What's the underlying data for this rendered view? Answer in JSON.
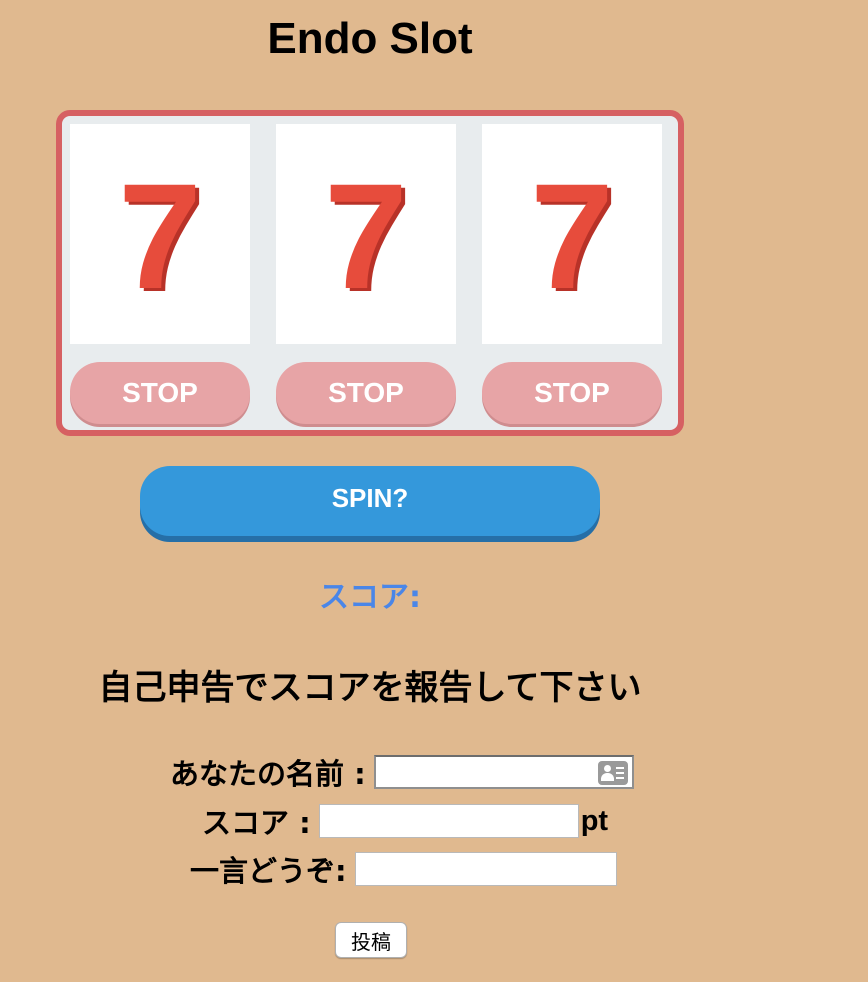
{
  "title": "Endo Slot",
  "reels": [
    {
      "symbol": "7",
      "stop_label": "STOP"
    },
    {
      "symbol": "7",
      "stop_label": "STOP"
    },
    {
      "symbol": "7",
      "stop_label": "STOP"
    }
  ],
  "spin_label": "SPIN?",
  "score_label": "スコア:",
  "report_heading": "自己申告でスコアを報告して下さい",
  "form": {
    "name_label": "あなたの名前 :",
    "name_value": "",
    "score_label": "スコア :",
    "score_value": "",
    "score_unit": "pt",
    "comment_label": "一言どうぞ:",
    "comment_value": "",
    "submit_label": "投稿",
    "autofill_icon": "contact-card-icon"
  },
  "colors": {
    "background": "#e0b98f",
    "frame": "#d66062",
    "seven": "#e74c3c",
    "stop_button": "#e7a4a6",
    "spin_button": "#3498db",
    "score_text": "#4a86e8"
  }
}
